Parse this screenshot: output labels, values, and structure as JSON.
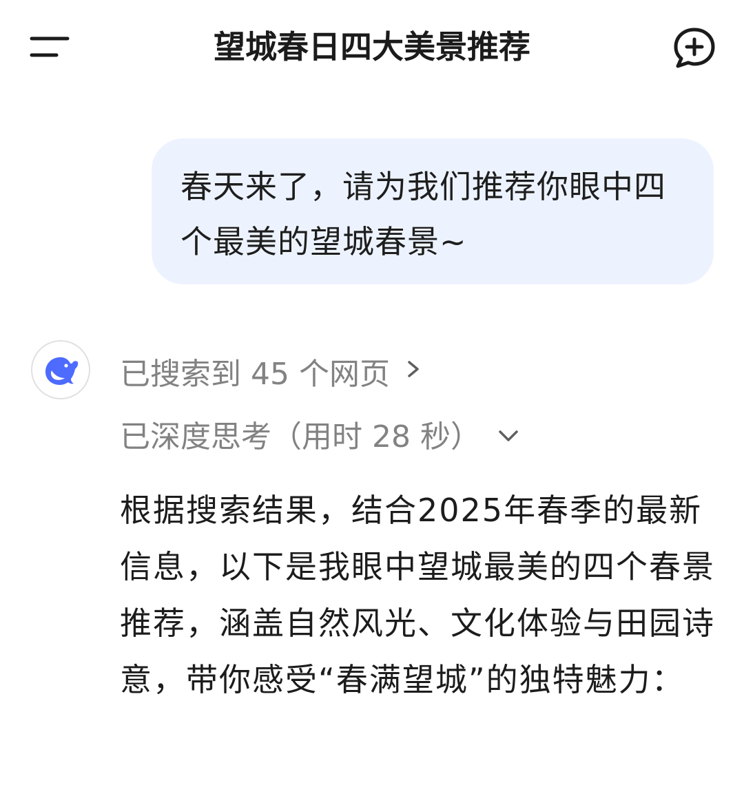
{
  "header": {
    "title": "望城春日四大美景推荐",
    "menu_icon": "menu-icon",
    "new_chat_icon": "new-chat-icon"
  },
  "conversation": {
    "user_message": "春天来了，请为我们推荐你眼中四个最美的望城春景~",
    "assistant": {
      "avatar_icon": "whale-logo-icon",
      "search_status": "已搜索到 45 个网页",
      "thinking_status": "已深度思考（用时 28 秒）",
      "answer_text": "根据搜索结果，结合2025年春季的最新信息，以下是我眼中望城最美的四个春景推荐，涵盖自然风光、文化体验与田园诗意，带你感受“春满望城”的独特魅力："
    }
  },
  "colors": {
    "bubble_bg": "#edf3fe",
    "brand_blue": "#4d6bfe",
    "meta_gray": "#828282"
  }
}
